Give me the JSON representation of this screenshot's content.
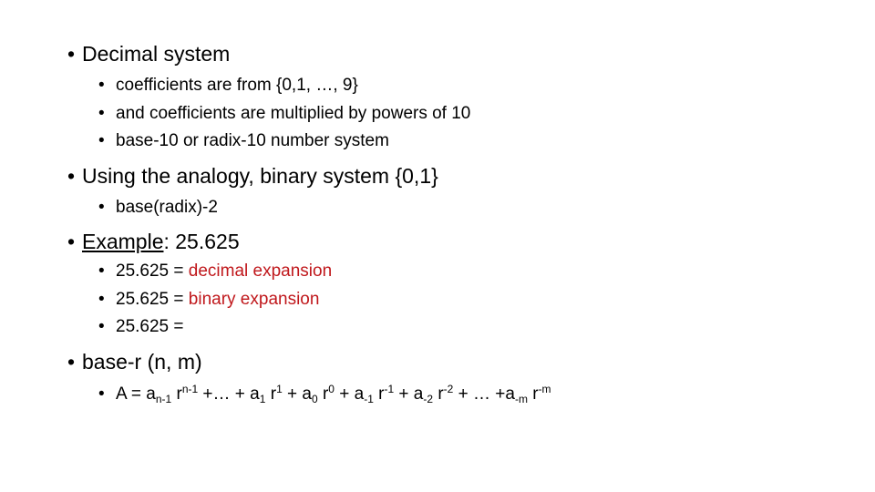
{
  "bullet_char": "•",
  "sections": [
    {
      "heading": "Decimal system",
      "items": [
        "coefficients are from {0,1, …, 9}",
        "and coefficients are multiplied by powers of 10",
        "base-10 or radix-10 number system"
      ]
    },
    {
      "heading": "Using the analogy, binary system {0,1}",
      "items": [
        "base(radix)-2"
      ]
    },
    {
      "heading_underlined": "Example",
      "heading_rest": ": 25.625",
      "items": [
        {
          "prefix": "25.625 = ",
          "highlight": "decimal expansion"
        },
        {
          "prefix": "25.625 = ",
          "highlight": "binary expansion"
        },
        {
          "prefix": "25.625 =",
          "highlight": ""
        }
      ]
    },
    {
      "heading": "base-r (n, m)",
      "formula": {
        "lhs": "A = a",
        "t1_sub": "n-1",
        "t1_r": " r",
        "t1_sup": "n-1",
        "t2": " +… + a",
        "t2_sub": "1",
        "t2_r": " r",
        "t2_sup": "1",
        "t3": " + a",
        "t3_sub": "0",
        "t3_r": " r",
        "t3_sup": "0",
        "t4": " + a",
        "t4_sub": "-1",
        "t4_r": " r",
        "t4_sup": "-1",
        "t5": " + a",
        "t5_sub": "-2",
        "t5_r": " r",
        "t5_sup": "-2",
        "t6": " + … +a",
        "t6_sub": "-m",
        "t6_r": " r",
        "t6_sup": "-m"
      }
    }
  ],
  "colors": {
    "highlight": "#c0181c",
    "text": "#000000"
  }
}
